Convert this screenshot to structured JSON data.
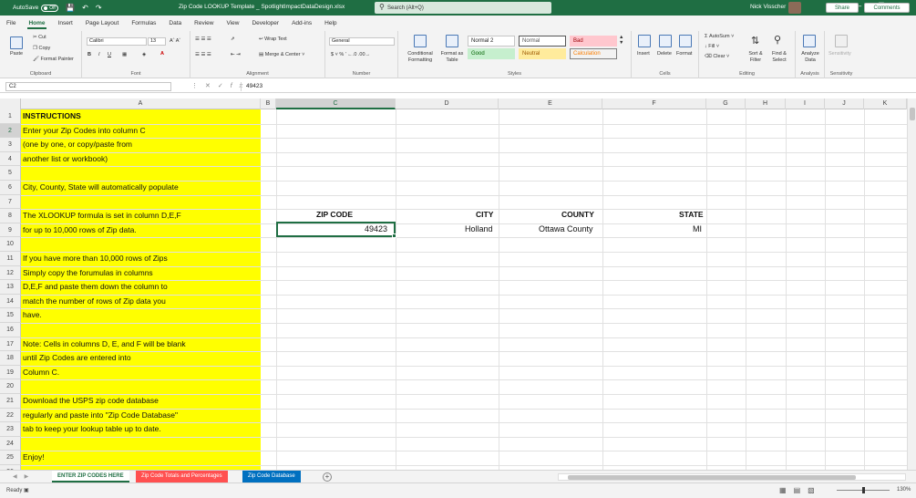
{
  "titlebar": {
    "autosave_label": "AutoSave",
    "autosave_state": "Off",
    "filename": "Zip Code LOOKUP Template _ SpotlightImpactDataDesign.xlsx",
    "search_placeholder": "Search (Alt+Q)",
    "user_name": "Nick Visscher"
  },
  "ribbon_tabs": [
    "File",
    "Home",
    "Insert",
    "Page Layout",
    "Formulas",
    "Data",
    "Review",
    "View",
    "Developer",
    "Add-ins",
    "Help"
  ],
  "active_tab": "Home",
  "share_label": "Share",
  "comments_label": "Comments",
  "ribbon": {
    "clipboard": {
      "label": "Clipboard",
      "paste": "Paste",
      "cut": "Cut",
      "copy": "Copy",
      "format_painter": "Format Painter"
    },
    "font": {
      "label": "Font",
      "font_name": "Calibri",
      "font_size": "13"
    },
    "alignment": {
      "label": "Alignment",
      "wrap_text": "Wrap Text",
      "merge_center": "Merge & Center"
    },
    "number": {
      "label": "Number",
      "format": "General"
    },
    "styles": {
      "label": "Styles",
      "conditional": "Conditional Formatting",
      "format_table": "Format as Table",
      "cells": [
        {
          "name": "Normal 2",
          "bg": "#ffffff",
          "fg": "#222222",
          "border": "#c6c6c6"
        },
        {
          "name": "Normal",
          "bg": "#ffffff",
          "fg": "#555555",
          "border": "#555555"
        },
        {
          "name": "Bad",
          "bg": "#ffc7ce",
          "fg": "#9c0006",
          "border": "#ffc7ce"
        },
        {
          "name": "Good",
          "bg": "#c6efce",
          "fg": "#006100",
          "border": "#c6efce"
        },
        {
          "name": "Neutral",
          "bg": "#ffeb9c",
          "fg": "#9c5700",
          "border": "#ffeb9c"
        },
        {
          "name": "Calculation",
          "bg": "#f2f2f2",
          "fg": "#fa7d00",
          "border": "#7f7f7f"
        }
      ]
    },
    "cells_group": {
      "label": "Cells",
      "insert": "Insert",
      "delete": "Delete",
      "format": "Format"
    },
    "editing": {
      "label": "Editing",
      "autosum": "AutoSum",
      "fill": "Fill",
      "clear": "Clear",
      "sort_filter": "Sort & Filter",
      "find_select": "Find & Select"
    },
    "analysis": {
      "label": "Analysis",
      "analyze_data": "Analyze Data"
    },
    "sensitivity": {
      "label": "Sensitivity",
      "button": "Sensitivity"
    }
  },
  "formula_bar": {
    "name_box": "C2",
    "formula": "49423"
  },
  "columns": [
    "A",
    "B",
    "C",
    "D",
    "E",
    "F",
    "G",
    "H",
    "I",
    "J",
    "K"
  ],
  "selected_column": "C",
  "selected_row": "2",
  "rows": [
    "1",
    "2",
    "3",
    "4",
    "5",
    "6",
    "7",
    "8",
    "9",
    "10",
    "11",
    "12",
    "13",
    "14",
    "15",
    "16",
    "17",
    "18",
    "19",
    "20",
    "21",
    "22",
    "23",
    "24",
    "25",
    "26"
  ],
  "column_a": [
    "INSTRUCTIONS",
    "Enter your Zip Codes into column C",
    "(one by one, or copy/paste from",
    "another list or workbook)",
    "",
    "City, County, State will automatically populate",
    "",
    "The XLOOKUP formula is set in column D,E,F",
    "for up to 10,000 rows of Zip data.",
    "",
    "If you have more than 10,000 rows of Zips",
    "Simply copy the forumulas in columns",
    "D,E,F and paste them down the column to",
    "match the number of rows of Zip data you",
    "have.",
    "",
    "Note: Cells in columns D, E, and F will be blank",
    "until Zip Codes are entered into",
    "Column C.",
    "",
    "Download the USPS zip code database",
    "regularly and paste into \"Zip Code Database\"",
    "tab to keep your lookup table up to date.",
    "",
    "Enjoy!",
    ""
  ],
  "headers": {
    "zip": "ZIP CODE",
    "city": "CITY",
    "county": "COUNTY",
    "state": "STATE"
  },
  "row2": {
    "zip": "49423",
    "city": "Holland",
    "county": "Ottawa County",
    "state": "MI"
  },
  "sheet_tabs": [
    {
      "name": "ENTER  ZIP CODES HERE",
      "active": true,
      "color": "#ffffff"
    },
    {
      "name": "Zip Code Totals and Percentages",
      "active": false,
      "color": "#ff5050"
    },
    {
      "name": "Zip Code Database",
      "active": false,
      "color": "#0070c0"
    }
  ],
  "status": {
    "ready": "Ready",
    "zoom": "130%"
  }
}
